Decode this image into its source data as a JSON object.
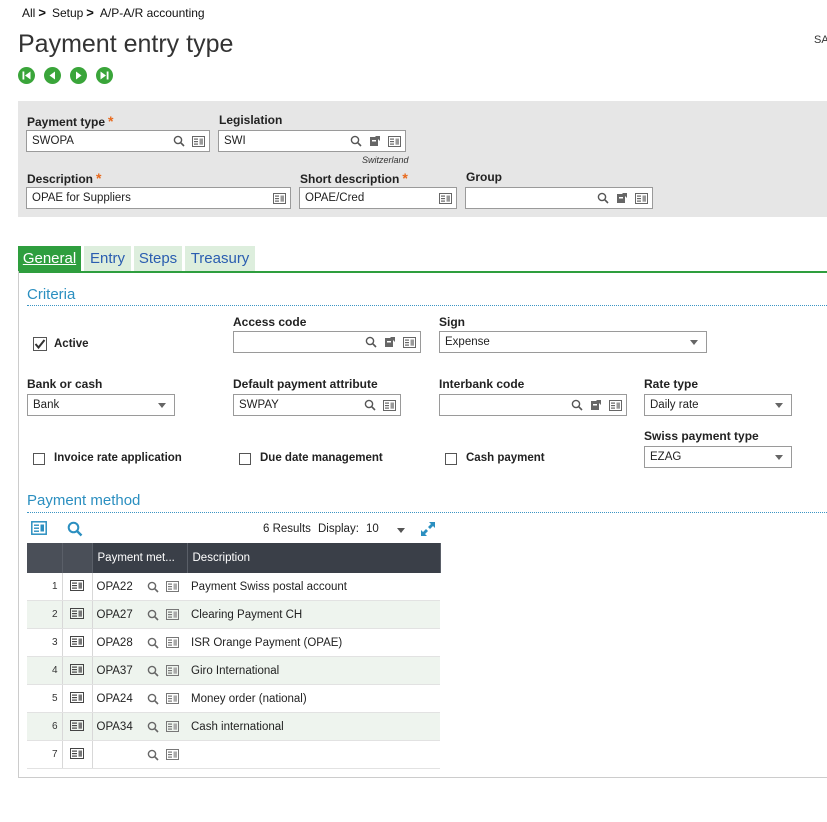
{
  "breadcrumb": {
    "items": [
      "All",
      "Setup",
      "A/P-A/R accounting"
    ],
    "separator": ">"
  },
  "page": {
    "title": "Payment entry type",
    "user": "SA"
  },
  "header": {
    "payment_type": {
      "label": "Payment type",
      "value": "SWOPA",
      "required": "*"
    },
    "legislation": {
      "label": "Legislation",
      "value": "SWI",
      "hint": "Switzerland"
    },
    "description": {
      "label": "Description",
      "value": "OPAE for Suppliers",
      "required": "*"
    },
    "short_description": {
      "label": "Short description",
      "value": "OPAE/Cred",
      "required": "*"
    },
    "group": {
      "label": "Group",
      "value": ""
    }
  },
  "tabs": [
    {
      "label": "General"
    },
    {
      "label": "Entry"
    },
    {
      "label": "Steps"
    },
    {
      "label": "Treasury"
    }
  ],
  "criteria": {
    "title": "Criteria",
    "active": {
      "label": "Active",
      "checked": true
    },
    "access_code": {
      "label": "Access code",
      "value": ""
    },
    "sign": {
      "label": "Sign",
      "value": "Expense"
    },
    "bank_or_cash": {
      "label": "Bank or cash",
      "value": "Bank"
    },
    "default_payment_attribute": {
      "label": "Default payment attribute",
      "value": "SWPAY"
    },
    "interbank_code": {
      "label": "Interbank code",
      "value": ""
    },
    "rate_type": {
      "label": "Rate type",
      "value": "Daily rate"
    },
    "invoice_rate_application": {
      "label": "Invoice rate application",
      "checked": false
    },
    "due_date_management": {
      "label": "Due date management",
      "checked": false
    },
    "cash_payment": {
      "label": "Cash payment",
      "checked": false
    },
    "swiss_payment_type": {
      "label": "Swiss payment type",
      "value": "EZAG"
    }
  },
  "payment_method": {
    "title": "Payment method",
    "results": "6 Results",
    "display_label": "Display:",
    "display_value": "10",
    "columns": [
      "Payment met...",
      "Description"
    ],
    "rows": [
      {
        "n": "1",
        "code": "OPA22",
        "desc": "Payment Swiss postal account"
      },
      {
        "n": "2",
        "code": "OPA27",
        "desc": "Clearing Payment CH"
      },
      {
        "n": "3",
        "code": "OPA28",
        "desc": "ISR Orange Payment (OPAE)"
      },
      {
        "n": "4",
        "code": "OPA37",
        "desc": "Giro International"
      },
      {
        "n": "5",
        "code": "OPA24",
        "desc": "Money order (national)"
      },
      {
        "n": "6",
        "code": "OPA34",
        "desc": "Cash international"
      },
      {
        "n": "7",
        "code": "",
        "desc": ""
      }
    ]
  },
  "colors": {
    "accent_green": "#2e9e3e",
    "nav_green": "#3aa53a",
    "section_blue": "#2b8fc0",
    "required_orange": "#e8691c",
    "grid_header": "#3a3f48"
  }
}
